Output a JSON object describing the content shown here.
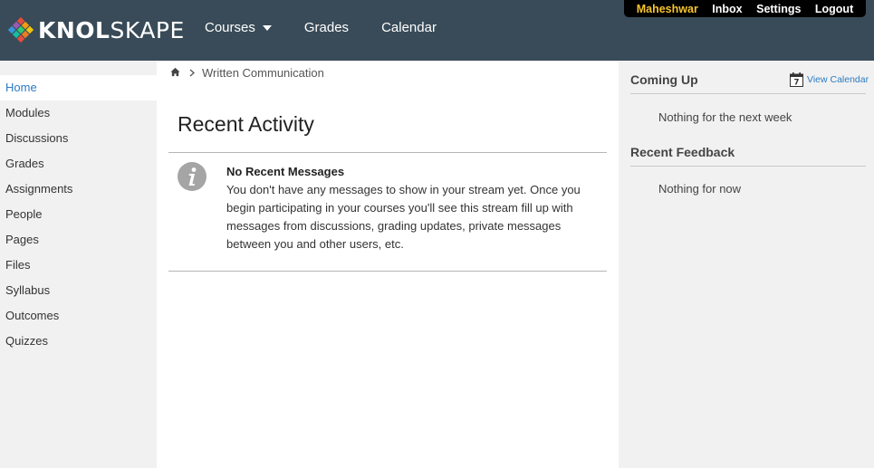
{
  "brand": {
    "logo_text_bold": "KNOL",
    "logo_text_light": "SKAPE",
    "colors": {
      "header_bg": "#394b58",
      "user_name": "#f8c52c",
      "link": "#2d7bc2"
    }
  },
  "main_nav": {
    "courses": "Courses",
    "grades": "Grades",
    "calendar": "Calendar"
  },
  "user_bar": {
    "user_name": "Maheshwar",
    "inbox": "Inbox",
    "settings": "Settings",
    "logout": "Logout"
  },
  "left_nav": {
    "items": [
      {
        "label": "Home",
        "active": true
      },
      {
        "label": "Modules"
      },
      {
        "label": "Discussions"
      },
      {
        "label": "Grades"
      },
      {
        "label": "Assignments"
      },
      {
        "label": "People"
      },
      {
        "label": "Pages"
      },
      {
        "label": "Files"
      },
      {
        "label": "Syllabus"
      },
      {
        "label": "Outcomes"
      },
      {
        "label": "Quizzes"
      }
    ]
  },
  "breadcrumb": {
    "home_icon": "home-icon",
    "course": "Written Communication"
  },
  "main": {
    "title": "Recent Activity",
    "message_icon": "info-icon",
    "message_title": "No Recent Messages",
    "message_body": "You don't have any messages to show in your stream yet. Once you begin participating in your courses you'll see this stream fill up with messages from discussions, grading updates, private messages between you and other users, etc."
  },
  "right_sidebar": {
    "coming_up_heading": "Coming Up",
    "view_calendar": "View Calendar",
    "calendar_icon_day": "7",
    "coming_up_empty": "Nothing for the next week",
    "recent_feedback_heading": "Recent Feedback",
    "recent_feedback_empty": "Nothing for now"
  }
}
